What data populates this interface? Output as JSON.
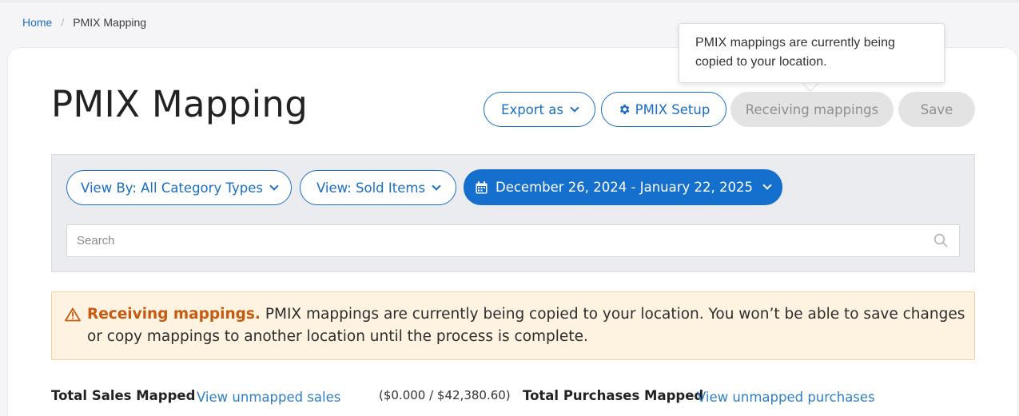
{
  "breadcrumb": {
    "home": "Home",
    "current": "PMIX Mapping"
  },
  "page": {
    "title": "PMIX Mapping"
  },
  "actions": {
    "export": "Export as",
    "setup": "PMIX Setup",
    "receiving": "Receiving mappings",
    "save": "Save"
  },
  "tooltip": {
    "text": "PMIX mappings are currently being copied to your location."
  },
  "filters": {
    "view_by": "View By: All Category Types",
    "view": "View: Sold Items",
    "date_range": "December 26, 2024 - January 22, 2025"
  },
  "search": {
    "placeholder": "Search",
    "value": ""
  },
  "alert": {
    "title": "Receiving mappings.",
    "message": "PMIX mappings are currently being copied to your location. You won’t be able to save changes or copy mappings to another location until the process is complete."
  },
  "stats": {
    "sales_label": "Total Sales Mapped",
    "sales_link": "View unmapped sales",
    "sales_value": "($0.000 / $42,380.60)",
    "purchases_label": "Total Purchases Mapped",
    "purchases_link": "View unmapped purchases"
  },
  "colors": {
    "accent": "#1470cc",
    "warning_bg": "#fef3e0",
    "warning_title": "#c65a10",
    "disabled_bg": "#e3e3e3"
  },
  "icons": {
    "setup": "gear-icon",
    "date": "calendar-icon",
    "search": "search-icon",
    "alert": "warning-triangle-icon",
    "dropdown": "chevron-down-icon"
  }
}
